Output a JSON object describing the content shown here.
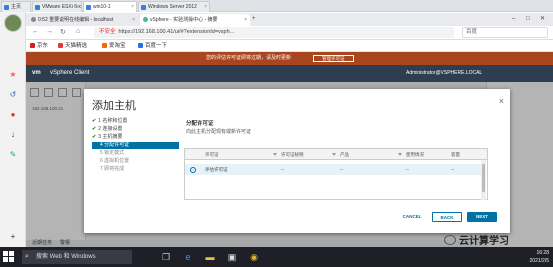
{
  "os_tabs": [
    {
      "label": "主页"
    },
    {
      "label": "VMware ESXi 6.x"
    },
    {
      "label": "win10-1"
    },
    {
      "label": "Windows Server 2012"
    }
  ],
  "browser": {
    "tabs": [
      {
        "label": "0:52 重要说明在线编辑 - localhost"
      },
      {
        "label": "vSphere - 实验测操中心 - 摘要"
      }
    ],
    "security_label": "不安全",
    "url": "https://192.168.100.41/ui/#?extensionId=vsph...",
    "search_placeholder": "百度",
    "bookmarks": [
      {
        "label": "京东",
        "color": "#d61d1d"
      },
      {
        "label": "天猫精选",
        "color": "#e4393c"
      },
      {
        "label": "爱淘宝",
        "color": "#f56a00"
      },
      {
        "label": "百度一下",
        "color": "#2b6de5"
      }
    ]
  },
  "vsphere": {
    "banner_message": "您的评估许可证即将过期，请及时更新",
    "banner_button": "管理许可证",
    "app_name": "vSphere Client",
    "user": "Administrator@VSPHERE.LOCAL",
    "tree_item": "192.168.100.41",
    "recent_tasks": "近期任务",
    "alarms": "警报"
  },
  "modal": {
    "title": "添加主机",
    "steps": [
      {
        "label": "1 名称和位置",
        "done": true
      },
      {
        "label": "2 连接设置",
        "done": true
      },
      {
        "label": "3 主机摘要",
        "done": true
      },
      {
        "label": "4 分配许可证",
        "done": false,
        "current": true
      },
      {
        "label": "5 锁定模式",
        "done": false
      },
      {
        "label": "6 虚拟机位置",
        "done": false
      },
      {
        "label": "7 即将完成",
        "done": false
      }
    ],
    "section_title": "分配许可证",
    "section_subtitle": "向此主机分配现有或新许可证",
    "columns": [
      "许可证",
      "许可证秘钥",
      "产品",
      "使用情况",
      "容量"
    ],
    "rows": [
      {
        "license": "评估许可证",
        "key": "--",
        "product": "--",
        "usage": "--",
        "capacity": "--",
        "selected": true
      }
    ],
    "buttons": {
      "cancel": "CANCEL",
      "back": "BACK",
      "next": "NEXT"
    }
  },
  "watermark": "云计算学习",
  "taskbar": {
    "search_placeholder": "搜索 Web 和 Windows",
    "time": "16:28",
    "date": "2021/2/5"
  }
}
